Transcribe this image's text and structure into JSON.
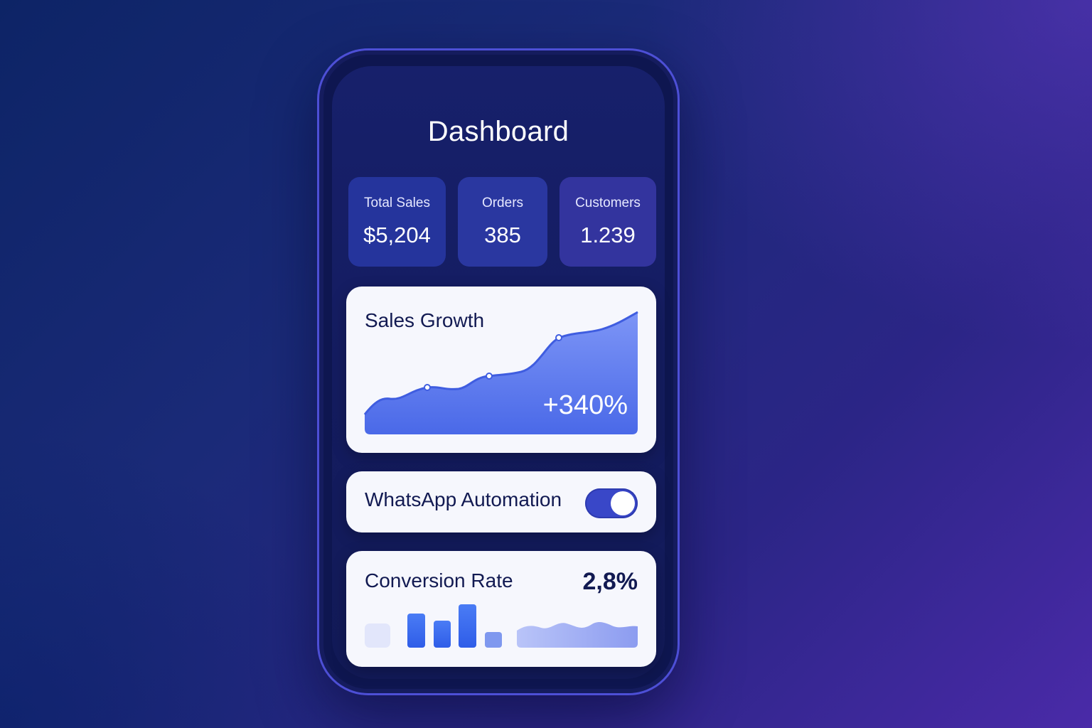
{
  "dashboard": {
    "title": "Dashboard",
    "stats": {
      "total_sales": {
        "label": "Total Sales",
        "value": "$5,204"
      },
      "orders": {
        "label": "Orders",
        "value": "385"
      },
      "customers": {
        "label": "Customers",
        "value": "1.239"
      }
    },
    "sales_growth": {
      "title": "Sales Growth",
      "value": "+340%"
    },
    "whatsapp": {
      "label": "WhatsApp Automation",
      "enabled": true
    },
    "conversion": {
      "title": "Conversion Rate",
      "value": "2,8%"
    }
  },
  "colors": {
    "accent": "#3947c8",
    "chart_fill": "#5a78ee",
    "card_bg": "#f6f7fd",
    "text_dark": "#121a52"
  },
  "icons": {
    "toggle": "toggle-switch"
  }
}
